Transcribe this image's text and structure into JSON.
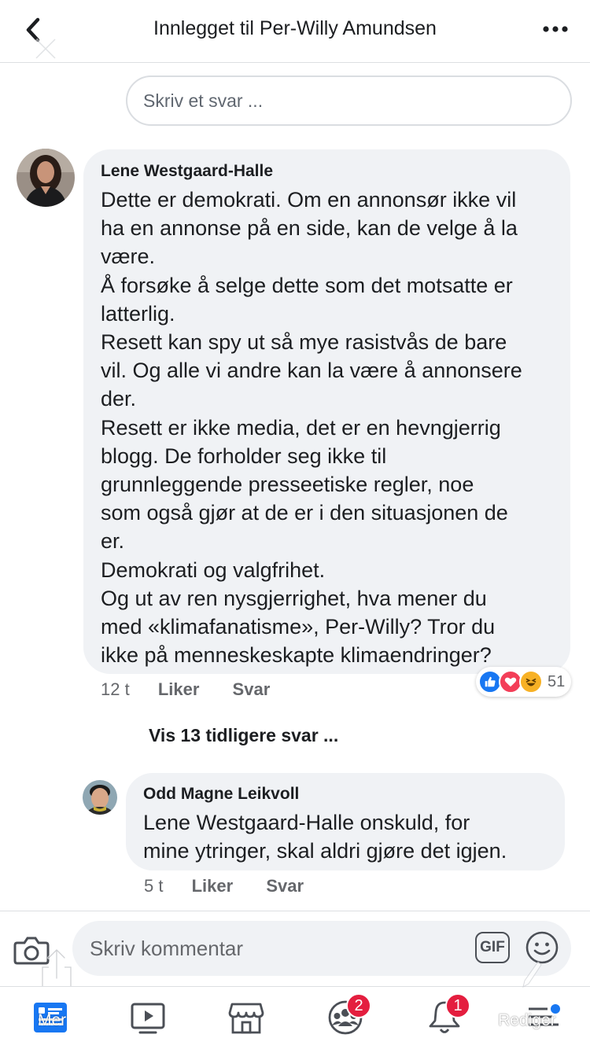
{
  "header": {
    "title": "Innlegget til Per-Willy Amundsen",
    "back_icon": "chevron-left-icon",
    "more_icon": "more-dots-icon"
  },
  "reply_box": {
    "placeholder": "Skriv et svar ..."
  },
  "comments": [
    {
      "author": "Lene Westgaard-Halle",
      "lines": [
        "Dette er demokrati. Om en annonsør ikke vil",
        "ha en annonse på en side, kan de velge å la",
        "være.",
        "Å forsøke å selge dette som det motsatte er",
        "latterlig.",
        "Resett kan spy ut så mye rasistvås de bare",
        "vil. Og alle vi andre kan la være å annonsere",
        "der.",
        "Resett er ikke media, det er en hevngjerrig",
        "blogg. De forholder seg ikke til",
        "grunnleggende presseetiske regler, noe",
        "som også gjør at de er i den situasjonen de",
        "er.",
        "Demokrati og valgfrihet.",
        "Og ut av ren nysgjerrighet, hva mener du",
        "med «klimafanatisme», Per-Willy? Tror du",
        "ikke på menneskeskapte klimaendringer?"
      ],
      "time": "12 t",
      "like_label": "Liker",
      "reply_label": "Svar",
      "reactions": {
        "icons": [
          "like-reaction-icon",
          "love-reaction-icon",
          "haha-reaction-icon"
        ],
        "count": "51"
      }
    },
    {
      "author": "Odd Magne Leikvoll",
      "lines": [
        "Lene Westgaard-Halle onskuld, for",
        "mine ytringer, skal  aldri gjøre det igjen."
      ],
      "time": "5 t",
      "like_label": "Liker",
      "reply_label": "Svar"
    }
  ],
  "previous_replies": "Vis 13 tidligere svar ...",
  "compose": {
    "placeholder": "Skriv kommentar",
    "gif_label": "GIF"
  },
  "tabbar": {
    "news_overlay": "Mer",
    "edit_overlay": "Rediger",
    "groups_badge": "2",
    "notifications_badge": "1"
  },
  "colors": {
    "accent": "#1877f2",
    "badge": "#e41e3f",
    "bubble": "#f0f2f5",
    "love": "#f33e58",
    "haha": "#f7b125"
  }
}
